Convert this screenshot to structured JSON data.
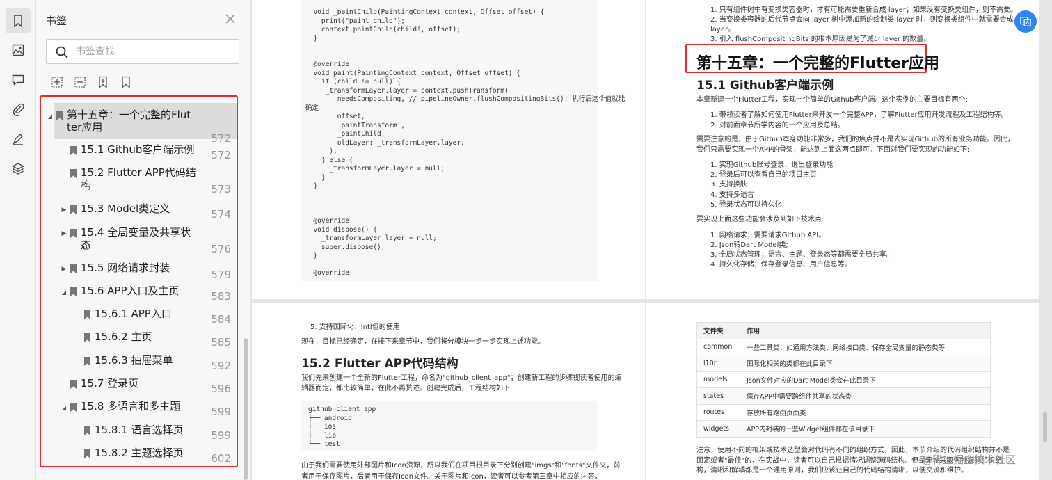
{
  "sidebar": {
    "title": "书签",
    "search_placeholder": "书签查找",
    "items": [
      {
        "label": "第十五章：一个完整的Flut",
        "label2": "ter应用",
        "page": "572",
        "level": 0,
        "expand": "open"
      },
      {
        "label": "15.1 Github客户端示例",
        "label2": "",
        "page": "572",
        "level": 1,
        "expand": "none"
      },
      {
        "label": "15.2 Flutter APP代码结",
        "label2": "构",
        "page": "573",
        "level": 1,
        "expand": "none"
      },
      {
        "label": "15.3 Model类定义",
        "label2": "",
        "page": "574",
        "level": 1,
        "expand": "closed"
      },
      {
        "label": "15.4 全局变量及共享状",
        "label2": "态",
        "page": "576",
        "level": 1,
        "expand": "closed"
      },
      {
        "label": "15.5 网络请求封装",
        "label2": "",
        "page": "579",
        "level": 1,
        "expand": "closed"
      },
      {
        "label": "15.6 APP入口及主页",
        "label2": "",
        "page": "583",
        "level": 1,
        "expand": "open"
      },
      {
        "label": "15.6.1 APP入口",
        "label2": "",
        "page": "584",
        "level": 2,
        "expand": "none"
      },
      {
        "label": "15.6.2 主页",
        "label2": "",
        "page": "585",
        "level": 2,
        "expand": "none"
      },
      {
        "label": "15.6.3 抽屉菜单",
        "label2": "",
        "page": "592",
        "level": 2,
        "expand": "none"
      },
      {
        "label": "15.7 登录页",
        "label2": "",
        "page": "596",
        "level": 1,
        "expand": "none"
      },
      {
        "label": "15.8 多语言和多主题",
        "label2": "",
        "page": "599",
        "level": 1,
        "expand": "open"
      },
      {
        "label": "15.8.1 语言选择页",
        "label2": "",
        "page": "599",
        "level": 2,
        "expand": "none"
      },
      {
        "label": "15.8.2 主题选择页",
        "label2": "",
        "page": "602",
        "level": 2,
        "expand": "none"
      }
    ]
  },
  "page_tl": {
    "code": "  void _paintChild(PaintingContext context, Offset offset) {\n    print(\"paint child\");\n    context.paintChild(child!, offset);\n  }\n\n\n  @override\n  void paint(PaintingContext context, Offset offset) {\n    if (child != null) {\n     _transformLayer.layer = context.pushTransform(\n        needsCompositing, // pipelineOwner.flushCompositingBits(); 执行后这个值就能\n确定\n        offset,\n        _paintTransform!,\n        _paintChild,\n        oldLayer: _transformLayer.layer,\n      );\n    } else {\n      _transformLayer.layer = null;\n    }\n  }\n\n\n\n  @override\n  void dispose() {\n    _transformLayer.layer = null;\n    super.dispose();\n  }\n\n  @override"
  },
  "page_tr": {
    "list_top": [
      "1. 只有组件树中有变换类容器时，才有可能需要重新合成 layer；如果没有变换类组件，则不需要。",
      "2. 当变换类容器的后代节点会向 layer 树中添加新的绘制类 layer 时，则变换类组件中就需要合成",
      "layer。",
      "3. 引入 flushCompositingBits 的根本原因是为了减少 layer 的数量。"
    ],
    "chapter_title": "第十五章：一个完整的Flutter应用",
    "section_title": "15.1 Github客户端示例",
    "intro": "本章新建一个Flutter工程，实现一个简单的Github客户端。这个实例的主要目标有两个:",
    "goals": [
      "1. 带领读者了解如何使用Flutter来开发一个完整APP，了解Flutter应用开发流程及工程结构等。",
      "2. 对前面章节所学内容的一个应用及总结。"
    ],
    "note1": "需要注意的是，由于Github本身功能非常多，我们的焦点并不是去实现Github的所有业务功能。因此，",
    "note2": "我们只需要实现一个APP的骨架，能达到上面这两点即可。下面对我们要实现的功能如下:",
    "features": [
      "1. 实现Github账号登录、退出登录功能",
      "2. 登录后可以查看自己的项目主页",
      "3. 支持换肤",
      "4. 支持多语言",
      "5. 登录状态可以持久化;"
    ],
    "tech_intro": "要实现上面这些功能会涉及到如下技术点:",
    "tech": [
      "1. 网络请求；需要请求Github API。",
      "2. Json转Dart Model类;",
      "3. 全局状态管理；语言、主题、登录态等都需要全局共享。",
      "4. 持久化存储；保存登录信息、用户信息等。"
    ]
  },
  "page_bl": {
    "item5": "5. 支持国际化、Intl包的使用",
    "p1": "现在，目标已经确定，在接下来章节中，我们将分模块一步一步实现上述功能。",
    "section_title": "15.2 Flutter APP代码结构",
    "p2a": "我们先来创建一个全新的Flutter工程，命名为\"github_client_app\"；创建新工程的步骤视读者使用的编",
    "p2b": "辑器而定，都比较简单，在此不再赘述。创建完成后，工程结构如下:",
    "tree": "github_client_app\n├── android\n├── ios\n├── lib\n└── test",
    "p3a": "由于我们需要使用外部图片和Icon资源，所以我们在项目根目录下分别创建\"imgs\"和\"fonts\"文件夹，前",
    "p3b": "者用于保存图片，后者用于保存Icon文件。关于图片和Icon，读者可以参考第三章中相应的内容。"
  },
  "page_br": {
    "headers": [
      "文件夹",
      "作用"
    ],
    "rows": [
      [
        "common",
        "一些工具类，如通用方法类、网络接口类、保存全局变量的静态类等"
      ],
      [
        "l10n",
        "国际化相关的类都在此目录下"
      ],
      [
        "models",
        "Json文件对应的Dart Model类会在此目录下"
      ],
      [
        "states",
        "保存APP中需要跨组件共享的状态类"
      ],
      [
        "routes",
        "存放所有路由页面类"
      ],
      [
        "widgets",
        "APP内封装的一些Widget组件都在该目录下"
      ]
    ],
    "p1": "注意，使用不同的框架或技术选型会对代码有不同的组织方式，因此，本节介绍的代码组织结构并不是",
    "p2": "固定或者\"最佳\"的，在实战中，读者可以自己根据情况调整源码结构。但是无论采取何种源码组织结",
    "p3": "构，清晰和解耦都是一个通用原则，我们应该让自己的代码结构清晰，以便交流和维护。"
  },
  "watermark": "@稀土掘金技术社区"
}
